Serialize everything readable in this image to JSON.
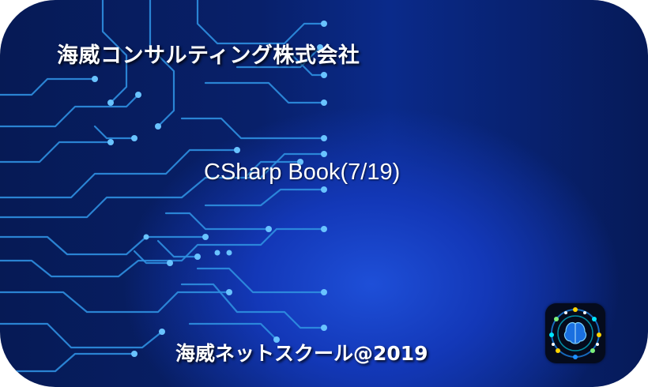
{
  "card": {
    "company_name": "海威コンサルティング株式会社",
    "book_title": "CSharp Book(7/19)",
    "footer_text": "海威ネットスクール@2019"
  },
  "logo": {
    "icon": "brain-network-icon",
    "colors": [
      "#1e90ff",
      "#ffd400",
      "#00e5ff",
      "#7cf17c"
    ]
  },
  "theme": {
    "background": "#0a2a8a",
    "circuit_color": "#2f8fe0",
    "node_color": "#69c3ff",
    "text_color": "#ffffff"
  }
}
